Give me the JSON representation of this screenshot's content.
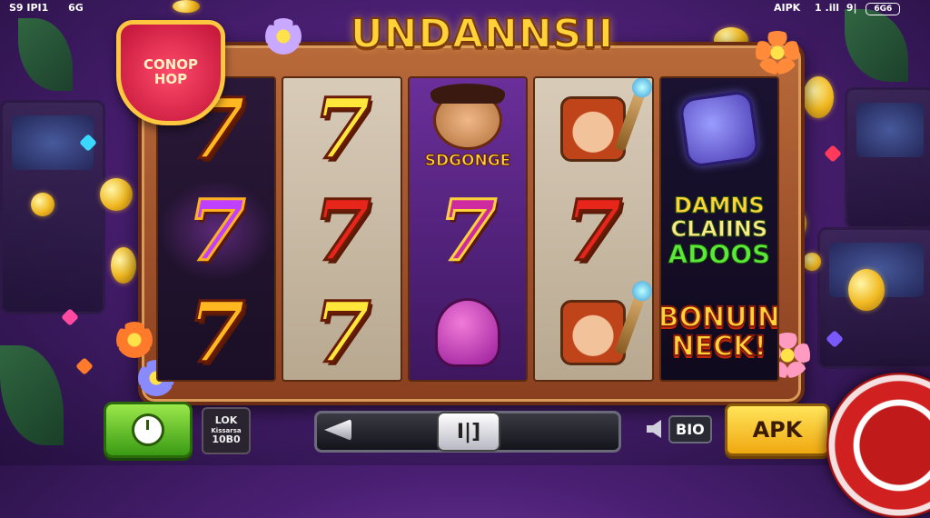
{
  "status_bar": {
    "left": "S9 IPI1",
    "left_icon_text": "6G",
    "right": "AIPK",
    "right_mid": "1 .ill",
    "right_signal": "9|",
    "battery_label": "6G6"
  },
  "game_title": "UNDANNSII",
  "badge": {
    "line1": "CONOP",
    "line2": "HOP"
  },
  "reels": [
    {
      "symbols": [
        "7",
        "7",
        "7"
      ],
      "tones": [
        "gold",
        "purple",
        "gold"
      ]
    },
    {
      "symbols": [
        "7",
        "7",
        "7"
      ],
      "tones": [
        "yellow",
        "red",
        "yellow"
      ]
    },
    {
      "top_label": "SDGONGE",
      "middle": "7",
      "middle_tone": "red",
      "bottom_icon": "octopus-icon"
    },
    {
      "top_icon": "hero-girl-icon",
      "middle": "7",
      "middle_tone": "red",
      "bottom_icon": "hero-girl-icon"
    },
    {
      "top_icon": "candy-bag-icon",
      "promo_lines": [
        "DAMNS",
        "CLAIINS",
        "ADOOS"
      ],
      "bonus_lines": [
        "BONUIN",
        "NECK!"
      ]
    }
  ],
  "controls": {
    "info_line1": "LOK",
    "info_line2": "Kissarsa",
    "info_line3": "10B0",
    "slider_knob": "I|]",
    "speaker_label": "BIO",
    "apk_button": "APK"
  },
  "colors": {
    "accent_gold": "#ffd23a",
    "frame_wood": "#a85a30",
    "spin_green": "#5ab820",
    "apk_yellow": "#f8c820"
  }
}
